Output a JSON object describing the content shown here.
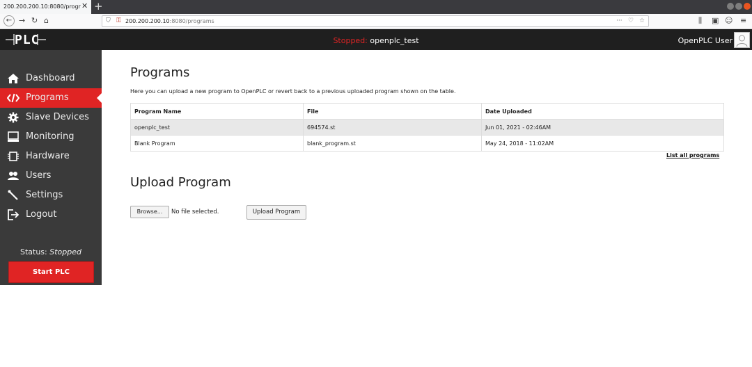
{
  "browser": {
    "tab_title": "200.200.200.10:8080/progr",
    "url_host": "200.200.200.10",
    "url_path": ":8080/programs"
  },
  "header": {
    "status_prefix": "Stopped:",
    "program_name": "openplc_test",
    "user_name": "OpenPLC User",
    "status_color": "#e02424"
  },
  "sidebar": {
    "items": [
      {
        "label": "Dashboard",
        "icon": "home-icon"
      },
      {
        "label": "Programs",
        "icon": "code-icon"
      },
      {
        "label": "Slave Devices",
        "icon": "cog-icon"
      },
      {
        "label": "Monitoring",
        "icon": "monitor-icon"
      },
      {
        "label": "Hardware",
        "icon": "chip-icon"
      },
      {
        "label": "Users",
        "icon": "users-icon"
      },
      {
        "label": "Settings",
        "icon": "wrench-icon"
      },
      {
        "label": "Logout",
        "icon": "logout-icon"
      }
    ],
    "active_index": 1,
    "status_label": "Status:",
    "status_value": "Stopped",
    "start_button": "Start PLC"
  },
  "main": {
    "title": "Programs",
    "intro": "Here you can upload a new program to OpenPLC or revert back to a previous uploaded program shown on the table.",
    "table": {
      "headers": [
        "Program Name",
        "File",
        "Date Uploaded"
      ],
      "rows": [
        [
          "openplc_test",
          "694574.st",
          "Jun 01, 2021 - 02:46AM"
        ],
        [
          "Blank Program",
          "blank_program.st",
          "May 24, 2018 - 11:02AM"
        ]
      ]
    },
    "list_all_link": "List all programs",
    "upload_title": "Upload Program",
    "browse_button": "Browse...",
    "file_label": "No file selected.",
    "upload_button": "Upload Program"
  },
  "colors": {
    "accent": "#e02424",
    "sidebar_bg": "#3a3a3a",
    "header_bg": "#1f1f1f"
  }
}
